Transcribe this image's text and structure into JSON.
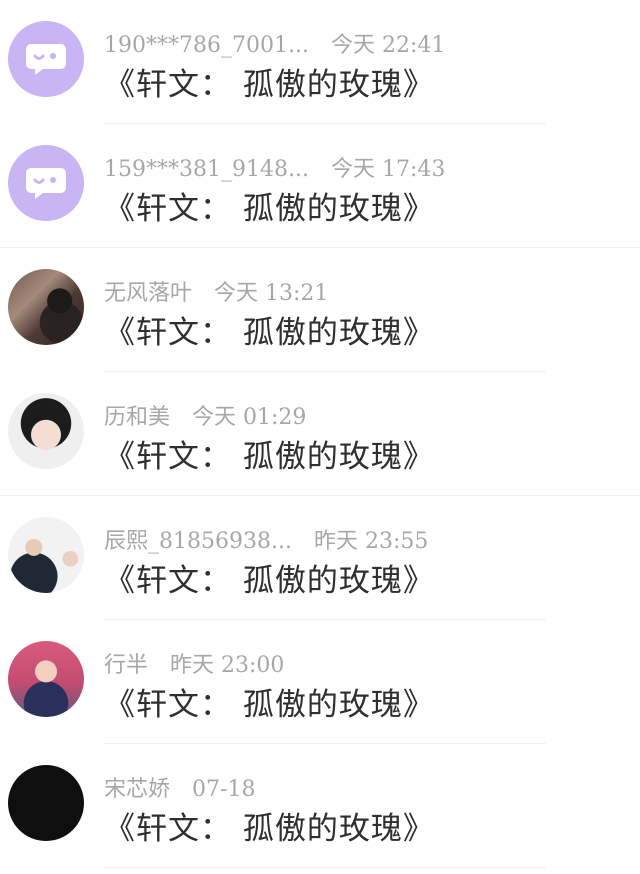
{
  "colors": {
    "background": "#ffffff",
    "meta_text": "#a7a7a7",
    "message_text": "#2f2f2f",
    "default_avatar": "#c9b4f4",
    "divider": "#f0f0f0"
  },
  "messages": [
    {
      "name": "190***786_7001...",
      "time": "今天 22:41",
      "text": "《轩文： 孤傲的玫瑰》",
      "avatar": "default-chat-avatar"
    },
    {
      "name": "159***381_9148...",
      "time": "今天 17:43",
      "text": "《轩文： 孤傲的玫瑰》",
      "avatar": "default-chat-avatar"
    },
    {
      "name": "无风落叶",
      "time": "今天 13:21",
      "text": "《轩文： 孤傲的玫瑰》",
      "avatar": "user-photo"
    },
    {
      "name": "历和美",
      "time": "今天 01:29",
      "text": "《轩文： 孤傲的玫瑰》",
      "avatar": "user-photo"
    },
    {
      "name": "辰熙_81856938...",
      "time": "昨天 23:55",
      "text": "《轩文： 孤傲的玫瑰》",
      "avatar": "user-photo"
    },
    {
      "name": "行半",
      "time": "昨天 23:00",
      "text": "《轩文： 孤傲的玫瑰》",
      "avatar": "user-photo"
    },
    {
      "name": "宋芯娇",
      "time": "07-18",
      "text": "《轩文： 孤傲的玫瑰》",
      "avatar": "user-photo"
    }
  ]
}
